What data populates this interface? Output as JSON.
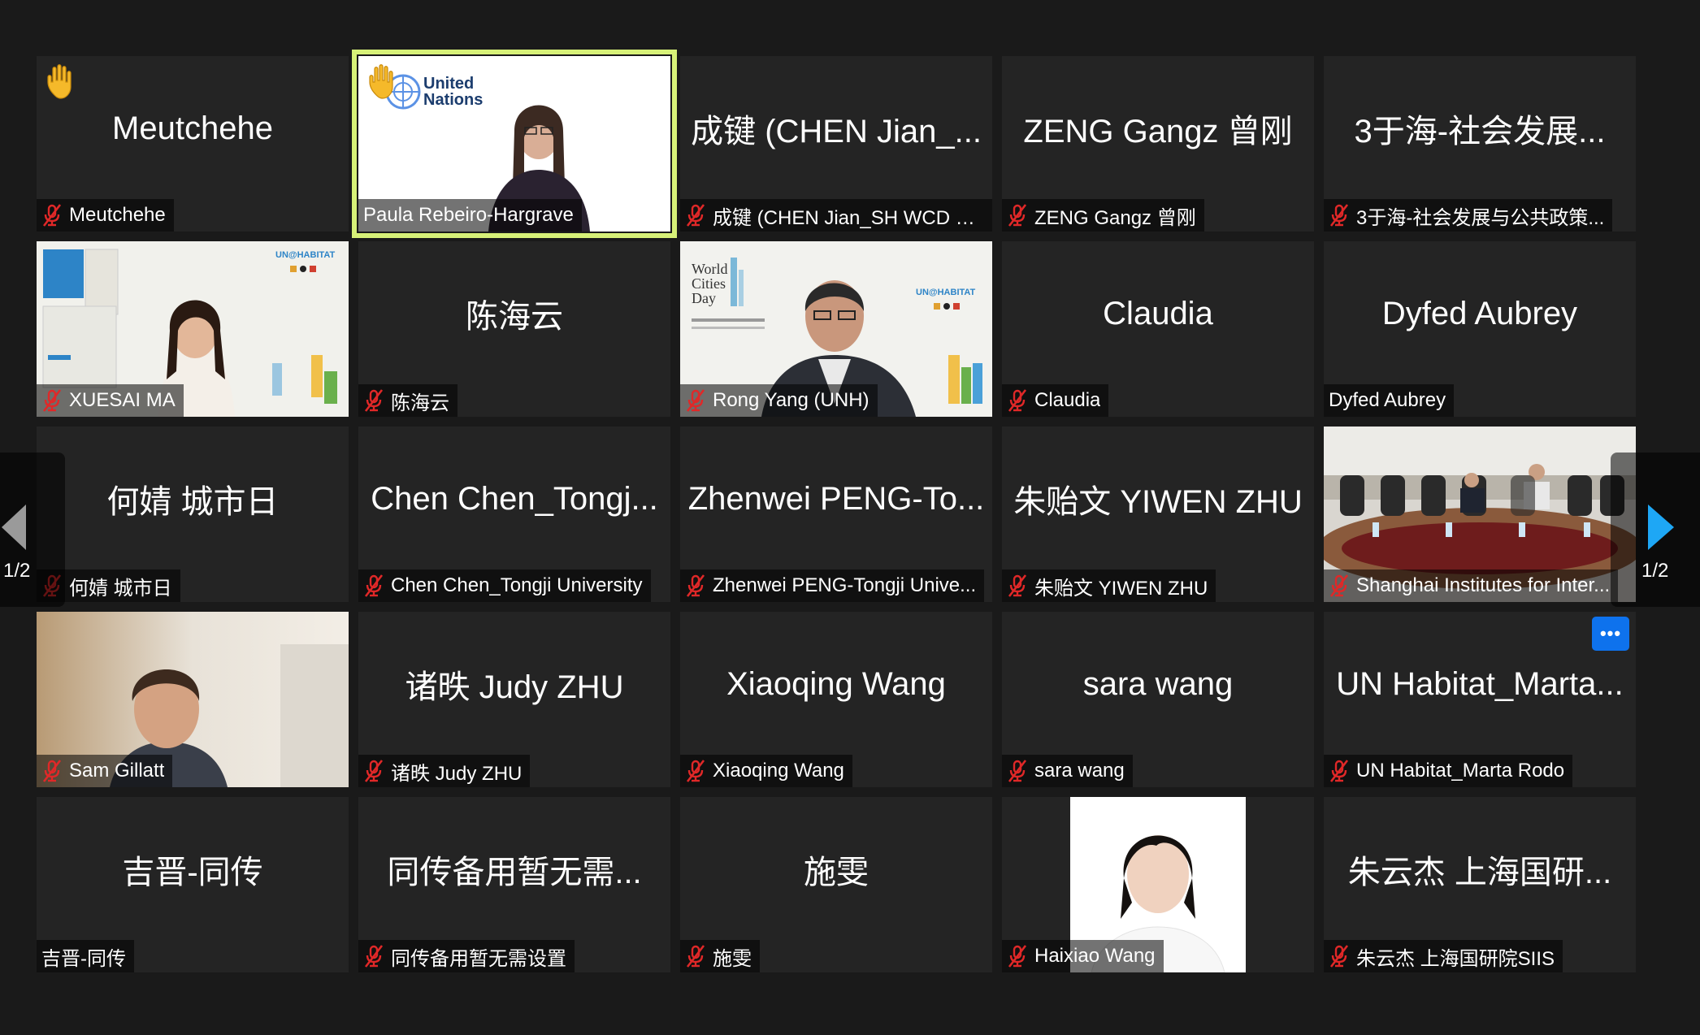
{
  "pagination": {
    "left_label": "1/2",
    "right_label": "1/2",
    "prev_icon": "triangle-left-icon",
    "next_icon": "triangle-right-icon"
  },
  "colors": {
    "background": "#1a1a1a",
    "tile": "#242424",
    "speaker_border": "#d7f178",
    "accent_blue": "#0e72ed",
    "muted_red": "#e02828"
  },
  "tiles": [
    {
      "big": "Meutchehe",
      "label": "Meutchehe",
      "muted": true,
      "hand": true
    },
    {
      "big": "",
      "label": "Paula Rebeiro-Hargrave",
      "muted": false,
      "video": "un-logo-video",
      "speaking": true,
      "hand": true,
      "logo_line1": "United",
      "logo_line2": "Nations"
    },
    {
      "big": "成键 (CHEN Jian_...",
      "label": "成键 (CHEN Jian_SH WCD C...",
      "muted": true
    },
    {
      "big": "ZENG Gangz 曾刚",
      "label": "ZENG Gangz 曾刚",
      "muted": true
    },
    {
      "big": "3于海-社会发展...",
      "label": "3于海-社会发展与公共政策...",
      "muted": true
    },
    {
      "big": "",
      "label": "XUESAI MA",
      "muted": true,
      "video": "unhabitat-video-woman",
      "brand": "UN@HABITAT"
    },
    {
      "big": "陈海云",
      "label": "陈海云",
      "muted": true
    },
    {
      "big": "",
      "label": "Rong Yang (UNH)",
      "muted": true,
      "video": "worldcities-video-man",
      "brand": "UN@HABITAT",
      "poster_line1": "World",
      "poster_line2": "Cities",
      "poster_line3": "Day"
    },
    {
      "big": "Claudia",
      "label": "Claudia",
      "muted": true
    },
    {
      "big": "Dyfed Aubrey",
      "label": "Dyfed Aubrey",
      "muted": false
    },
    {
      "big": "何婧 城市日",
      "label": "何婧 城市日",
      "muted": true
    },
    {
      "big": "Chen Chen_Tongj...",
      "label": "Chen Chen_Tongji University",
      "muted": true
    },
    {
      "big": "Zhenwei PENG-To...",
      "label": "Zhenwei PENG-Tongji Unive...",
      "muted": true
    },
    {
      "big": "朱贻文 YIWEN ZHU",
      "label": "朱贻文 YIWEN ZHU",
      "muted": true
    },
    {
      "big": "",
      "label": "Shanghai Institutes for Inter...",
      "muted": true,
      "video": "conference-room-video"
    },
    {
      "big": "",
      "label": "Sam Gillatt",
      "muted": true,
      "video": "man-video"
    },
    {
      "big": "诸昳 Judy ZHU",
      "label": "诸昳 Judy ZHU",
      "muted": true
    },
    {
      "big": "Xiaoqing Wang",
      "label": "Xiaoqing Wang",
      "muted": true
    },
    {
      "big": "sara wang",
      "label": "sara wang",
      "muted": true
    },
    {
      "big": "UN Habitat_Marta...",
      "label": "UN Habitat_Marta Rodo",
      "muted": true,
      "more": "•••"
    },
    {
      "big": "吉晋-同传",
      "label": "吉晋-同传",
      "muted": false
    },
    {
      "big": "同传备用暂无需...",
      "label": "同传备用暂无需设置",
      "muted": true
    },
    {
      "big": "施雯",
      "label": "施雯",
      "muted": true
    },
    {
      "big": "",
      "label": "Haixiao Wang",
      "muted": true,
      "video": "portrait-photo"
    },
    {
      "big": "朱云杰 上海国研...",
      "label": "朱云杰 上海国研院SIIS",
      "muted": true
    }
  ]
}
